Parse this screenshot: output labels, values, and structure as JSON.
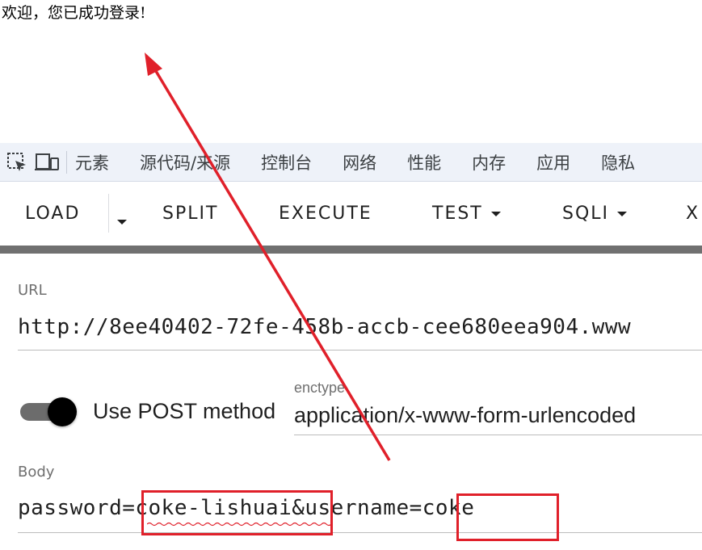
{
  "welcome_text": "欢迎，您已成功登录!",
  "devtools": {
    "tabs": [
      "元素",
      "源代码/来源",
      "控制台",
      "网络",
      "性能",
      "内存",
      "应用",
      "隐私"
    ],
    "icons": [
      "inspect-element-icon",
      "device-toolbar-icon"
    ]
  },
  "hackbar": {
    "buttons": {
      "load": "LOAD",
      "split": "SPLIT",
      "execute": "EXECUTE",
      "test": "TEST",
      "sqli": "SQLI",
      "xss": "X"
    }
  },
  "form": {
    "url_label": "URL",
    "url_value": "http://8ee40402-72fe-458b-accb-cee680eea904.www",
    "post_toggle_label": "Use POST method",
    "post_toggle_on": true,
    "enctype_label": "enctype",
    "enctype_value": "application/x-www-form-urlencoded",
    "body_label": "Body",
    "body_value": "password=coke-lishuai&username=coke"
  },
  "colors": {
    "annotation": "#e0202a",
    "devtools_bg": "#eef2f9"
  }
}
